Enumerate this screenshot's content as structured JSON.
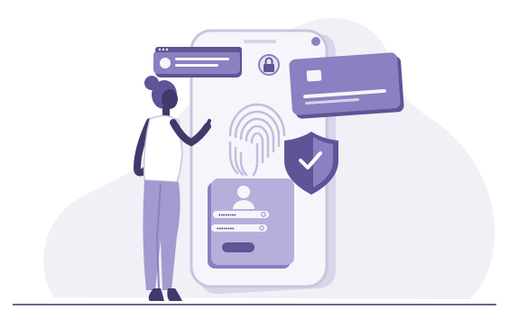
{
  "illustration": {
    "subject": "secure-login-phone",
    "icons": {
      "fingerprint": "fingerprint-icon",
      "lock": "lock-icon",
      "shield": "shield-check-icon",
      "user": "user-icon",
      "card": "credit-card-icon"
    },
    "login_form": {
      "username_mask": "••••••••",
      "password_mask": "••••••••"
    }
  },
  "colors": {
    "background_blob": "#f1f0f7",
    "phone_body": "#f6f5fb",
    "phone_outline": "#c9c5de",
    "primary": "#8a80c2",
    "primary_dark": "#5e5496",
    "primary_light": "#b7afdb",
    "ground": "#6b6496",
    "skin": "#3f3a6b"
  }
}
